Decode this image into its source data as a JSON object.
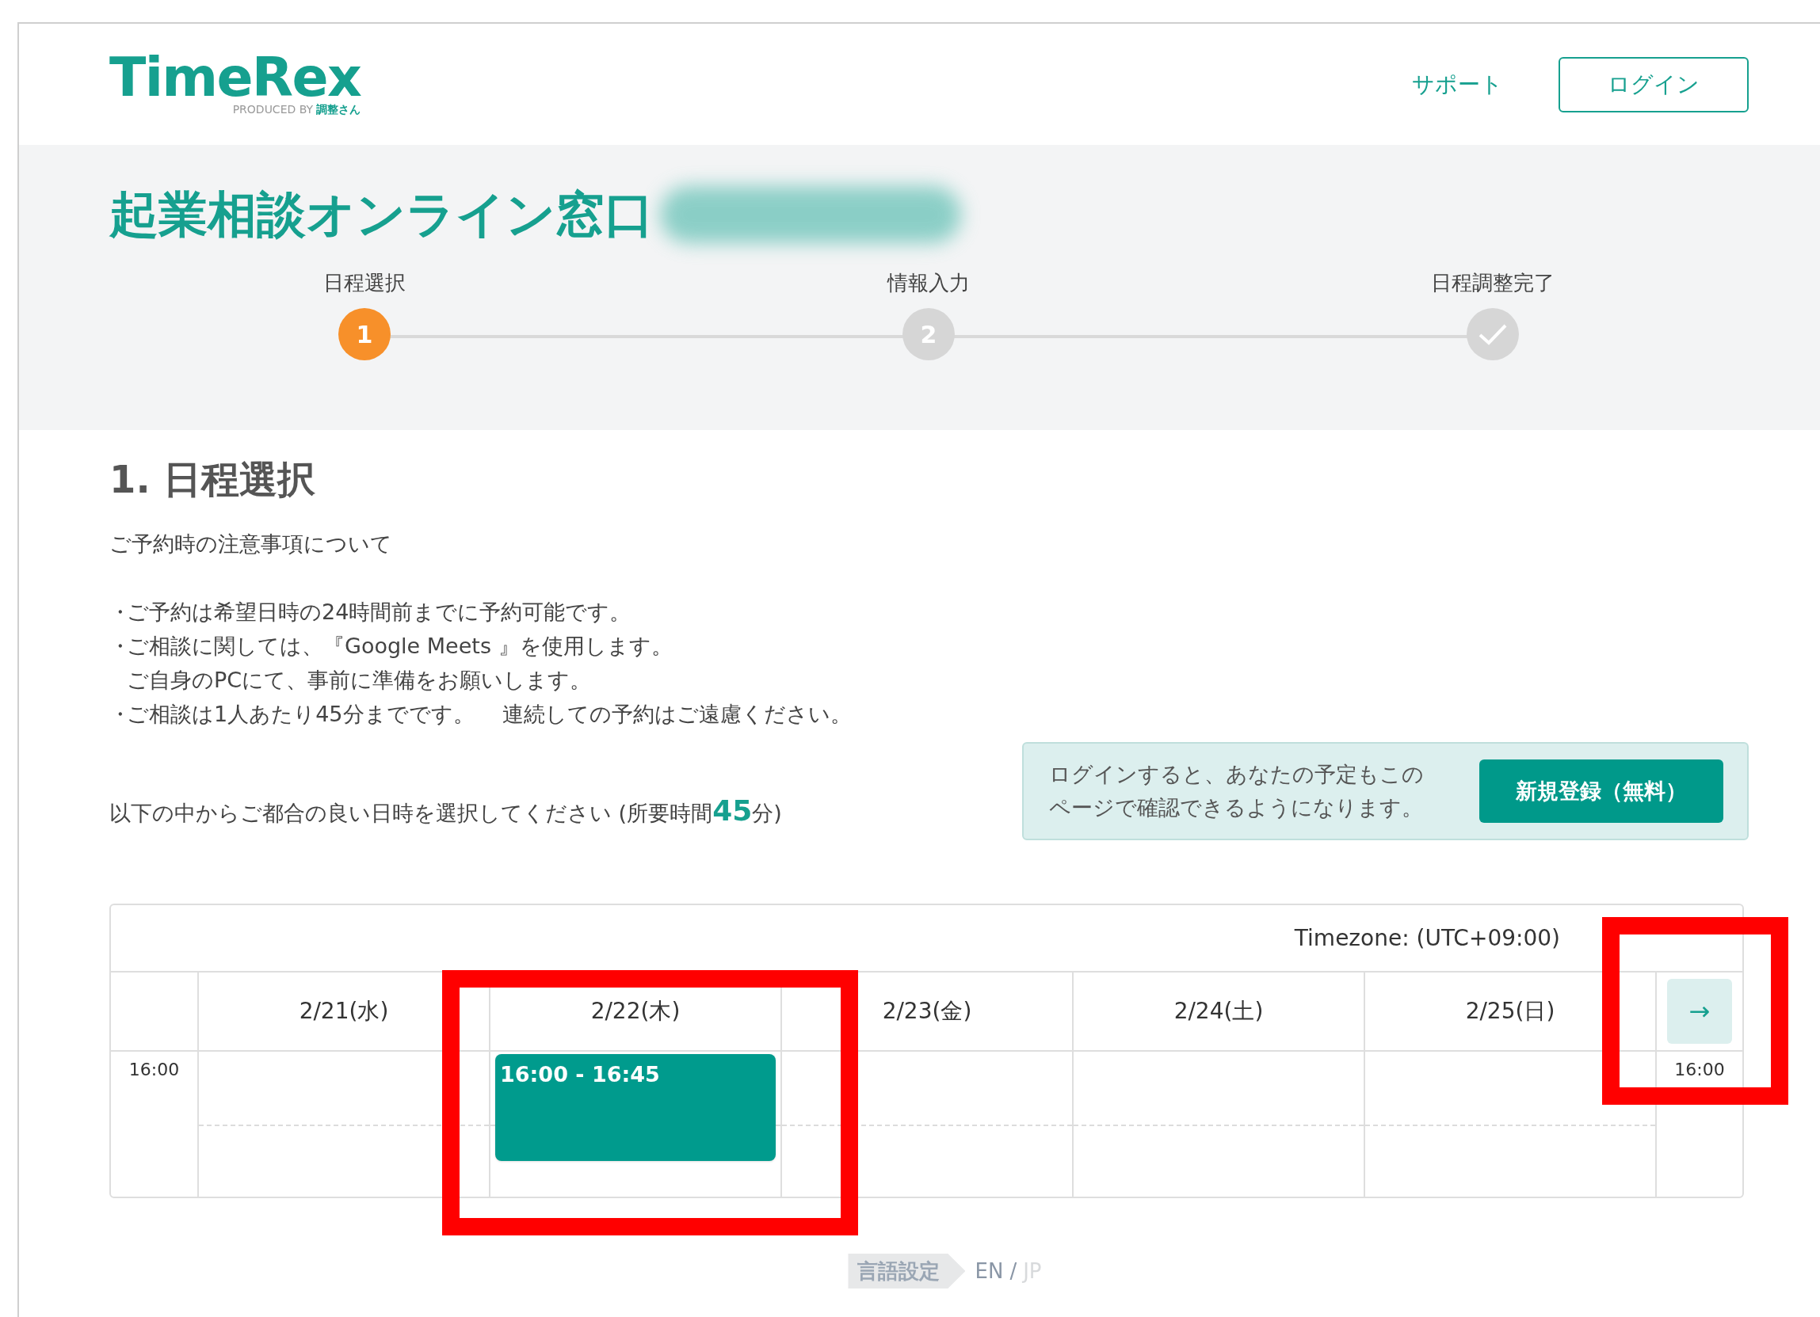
{
  "header": {
    "logo": "TimeRex",
    "logo_tagline": "PRODUCED BY",
    "logo_tagline_brand": "調整さん",
    "nav_link": "サポート",
    "login_button": "ログイン"
  },
  "title": "起業相談オンライン窓口",
  "steps": [
    {
      "label": "日程選択",
      "marker": "1",
      "kind": "number",
      "selected": true
    },
    {
      "label": "情報入力",
      "marker": "2",
      "kind": "number",
      "selected": false
    },
    {
      "label": "日程調整完了",
      "kind": "check",
      "selected": false
    }
  ],
  "section_heading": "1. 日程選択",
  "notes": {
    "heading": "ご予約時の注意事項について",
    "items": [
      {
        "bullet": "・",
        "lines": [
          "ご予約は希望日時の24時間前までに予約可能です。"
        ]
      },
      {
        "bullet": "・",
        "lines": [
          "ご相談に関しては、『Google Meets 』を使用します。",
          "ご自身のPCにて、事前に準備をお願いします。"
        ]
      },
      {
        "bullet": "・",
        "lines": [
          "ご相談は1人あたり45分までです。　 連続しての予約はご遠慮ください。"
        ]
      }
    ]
  },
  "instruction": {
    "prefix": "以下の中からご都合の良い日時を選択してください (所要時間",
    "duration": "45",
    "suffix": "分)"
  },
  "login_prompt": {
    "lines": [
      "ログインすると、あなたの予定もこの",
      "ページで確認できるようになります。"
    ],
    "button": "新規登録（無料）"
  },
  "calendar": {
    "timezone": "Timezone: (UTC+09:00)",
    "time_label": "16:00",
    "right_time_label": "16:00",
    "next_button": "→",
    "days": [
      {
        "label": "2/21(水)"
      },
      {
        "label": "2/22(木)",
        "slots": [
          {
            "time": "16:00 - 16:45"
          }
        ]
      },
      {
        "label": "2/23(金)"
      },
      {
        "label": "2/24(土)"
      },
      {
        "label": "2/25(日)"
      }
    ]
  },
  "annotations": [
    {
      "kind": "frame"
    },
    {
      "kind": "frame"
    }
  ],
  "language": {
    "label": "言語設定",
    "separator": "/",
    "options": [
      {
        "label": "EN",
        "selected": false
      },
      {
        "label": "JP",
        "selected": true
      }
    ]
  }
}
